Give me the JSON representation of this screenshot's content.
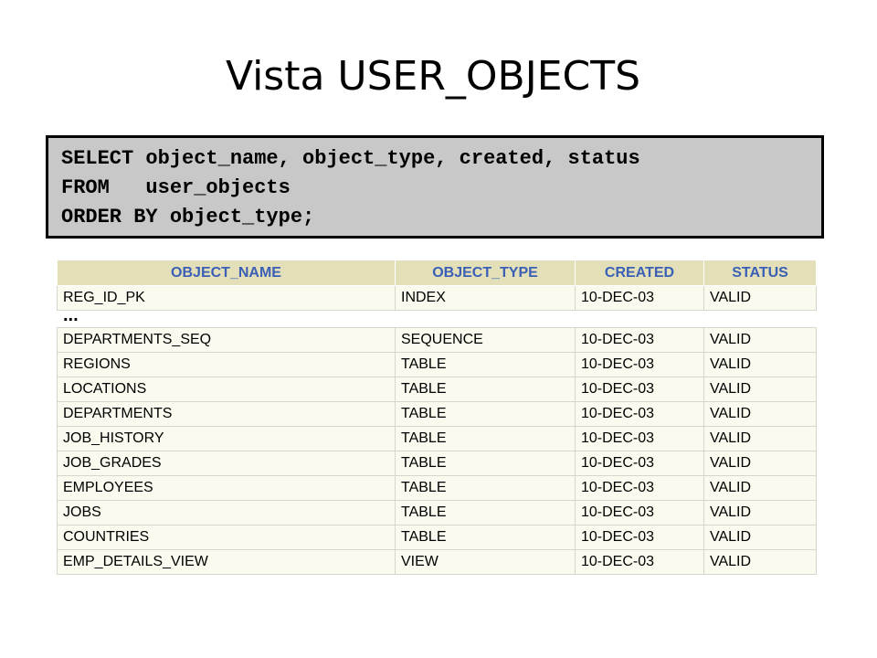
{
  "slide": {
    "title": "Vista USER_OBJECTS"
  },
  "code": {
    "lines": [
      "SELECT object_name, object_type, created, status",
      "FROM   user_objects",
      "ORDER BY object_type;"
    ]
  },
  "table": {
    "headers": [
      "OBJECT_NAME",
      "OBJECT_TYPE",
      "CREATED",
      "STATUS"
    ],
    "first_row": [
      "REG_ID_PK",
      "INDEX",
      "10-DEC-03",
      "VALID"
    ],
    "ellipsis": "...",
    "rows": [
      [
        "DEPARTMENTS_SEQ",
        "SEQUENCE",
        "10-DEC-03",
        "VALID"
      ],
      [
        "REGIONS",
        "TABLE",
        "10-DEC-03",
        "VALID"
      ],
      [
        "LOCATIONS",
        "TABLE",
        "10-DEC-03",
        "VALID"
      ],
      [
        "DEPARTMENTS",
        "TABLE",
        "10-DEC-03",
        "VALID"
      ],
      [
        "JOB_HISTORY",
        "TABLE",
        "10-DEC-03",
        "VALID"
      ],
      [
        "JOB_GRADES",
        "TABLE",
        "10-DEC-03",
        "VALID"
      ],
      [
        "EMPLOYEES",
        "TABLE",
        "10-DEC-03",
        "VALID"
      ],
      [
        "JOBS",
        "TABLE",
        "10-DEC-03",
        "VALID"
      ],
      [
        "COUNTRIES",
        "TABLE",
        "10-DEC-03",
        "VALID"
      ],
      [
        "EMP_DETAILS_VIEW",
        "VIEW",
        "10-DEC-03",
        "VALID"
      ]
    ]
  }
}
